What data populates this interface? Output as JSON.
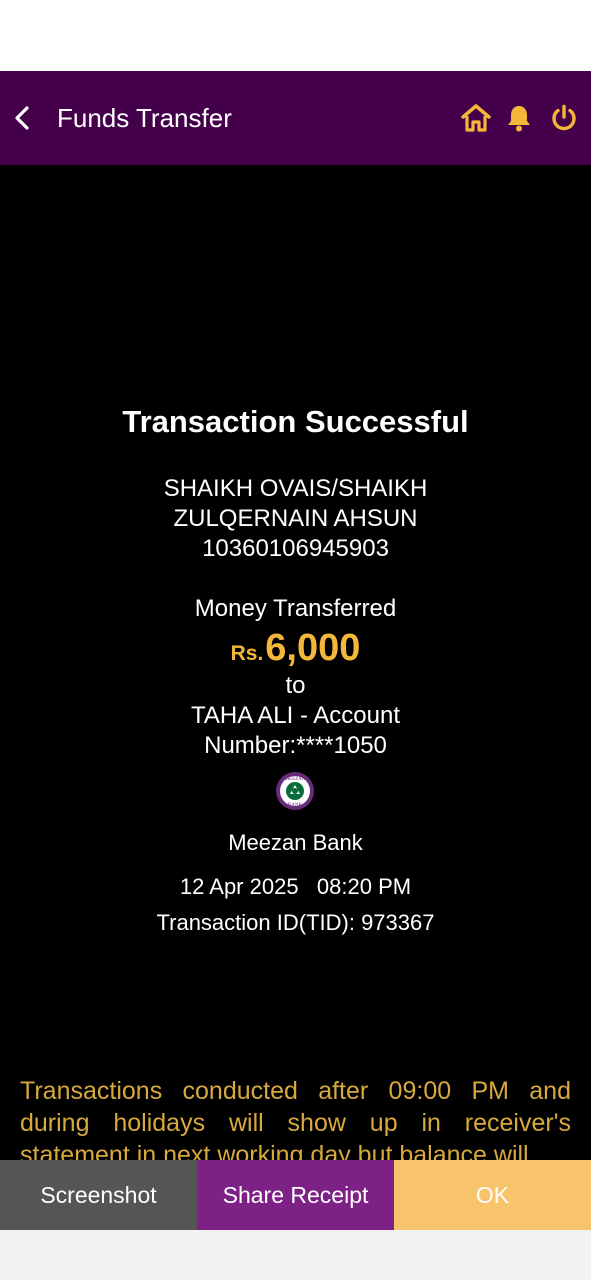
{
  "header": {
    "title": "Funds Transfer"
  },
  "receipt": {
    "status_title": "Transaction Successful",
    "sender_line1": "SHAIKH OVAIS/SHAIKH",
    "sender_line2": "ZULQERNAIN AHSUN",
    "sender_account": "10360106945903",
    "money_label": "Money Transferred",
    "currency": "Rs.",
    "amount": "6,000",
    "to_label": "to",
    "receiver_line1": "TAHA ALI  - Account",
    "receiver_line2": "Number:****1050",
    "bank_name": "Meezan Bank",
    "date": "12 Apr 2025",
    "time": "08:20 PM",
    "transaction_id": "Transaction ID(TID): 973367"
  },
  "notice": "Transactions conducted after 09:00 PM and during holidays will show up in receiver's statement in next working day but balance will",
  "actions": {
    "screenshot": "Screenshot",
    "share_receipt": "Share Receipt",
    "ok": "OK"
  },
  "colors": {
    "header_bg": "#44004a",
    "accent": "#f5b73a",
    "share_bg": "#7d2187",
    "ok_bg": "#f7c36b",
    "screenshot_bg": "#555555"
  },
  "icons": [
    "back-arrow-icon",
    "home-icon",
    "bell-icon",
    "power-icon",
    "meezan-bank-logo"
  ],
  "logo_text": "MEEZAN BANK"
}
